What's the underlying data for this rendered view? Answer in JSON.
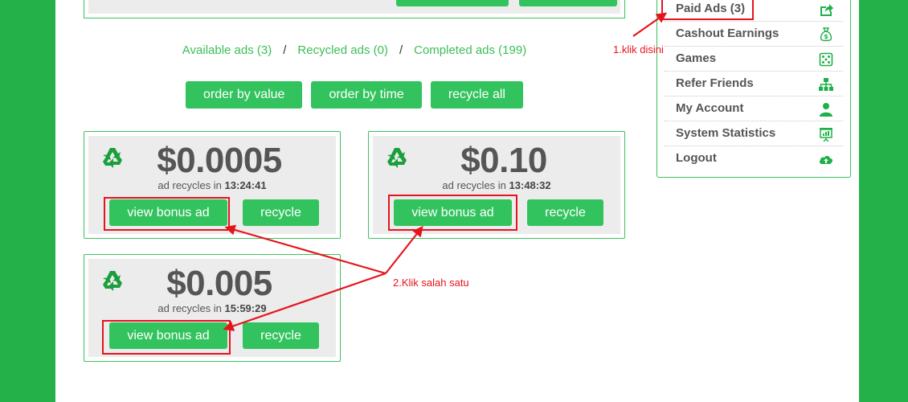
{
  "colors": {
    "background": "#25b14a",
    "button": "#33c35e",
    "link": "#3cbf56",
    "card_bg": "#ececec",
    "annotation": "#e5141c"
  },
  "tabs": [
    {
      "label": "Available ads (3)"
    },
    {
      "label": "Recycled ads (0)"
    },
    {
      "label": "Completed ads (199)"
    }
  ],
  "tab_separator": "/",
  "order_buttons": {
    "by_value": "order by value",
    "by_time": "order by time",
    "recycle_all": "recycle all"
  },
  "ads": [
    {
      "value": "$0.0005",
      "recycle_prefix": "ad recycles in",
      "recycle_time": "13:24:41",
      "view_label": "view bonus ad",
      "recycle_label": "recycle",
      "icon": "recycle-icon"
    },
    {
      "value": "$0.10",
      "recycle_prefix": "ad recycles in",
      "recycle_time": "13:48:32",
      "view_label": "view bonus ad",
      "recycle_label": "recycle",
      "icon": "recycle-icon"
    },
    {
      "value": "$0.005",
      "recycle_prefix": "ad recycles in",
      "recycle_time": "15:59:29",
      "view_label": "view bonus ad",
      "recycle_label": "recycle",
      "icon": "recycle-icon"
    }
  ],
  "menu": [
    {
      "label": "Paid Ads (3)",
      "icon": "share-icon"
    },
    {
      "label": "Cashout Earnings",
      "icon": "money-bag-icon"
    },
    {
      "label": "Games",
      "icon": "dice-icon"
    },
    {
      "label": "Refer Friends",
      "icon": "network-icon"
    },
    {
      "label": "My Account",
      "icon": "user-icon"
    },
    {
      "label": "System Statistics",
      "icon": "presentation-icon"
    },
    {
      "label": "Logout",
      "icon": "cloud-upload-icon"
    }
  ],
  "annotations": {
    "step1": "1.klik disini",
    "step2": "2.Klik salah satu"
  }
}
